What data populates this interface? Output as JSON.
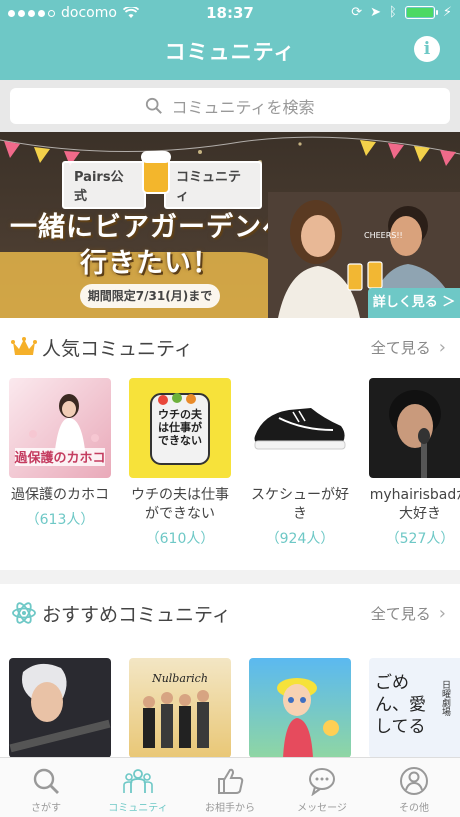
{
  "status_bar": {
    "carrier": "docomo",
    "time": "18:37"
  },
  "nav": {
    "title": "コミュニティ",
    "info_icon": "i"
  },
  "search": {
    "placeholder": "コミュニティを検索"
  },
  "banner": {
    "tag_left": "Pairs公式",
    "tag_right": "コミュニティ",
    "headline_line1": "一緒にビアガーデンへ",
    "headline_line2": "行きたい！",
    "period": "期間限定7/31(月)まで",
    "cheers": "CHEERS!!",
    "detail_button": "詳しく見る ＞"
  },
  "popular": {
    "title": "人気コミュニティ",
    "see_all": "全て見る",
    "items": [
      {
        "name": "過保護のカホコ",
        "count": "（613人）",
        "thumb_text": "過保護のカホコ"
      },
      {
        "name": "ウチの夫は仕事ができない",
        "count": "（610人）",
        "thumb_text": "ウチの夫は仕事ができない"
      },
      {
        "name": "スケシューが好き",
        "count": "（924人）"
      },
      {
        "name": "myhairisbadが大好き",
        "count": "（527人）"
      }
    ]
  },
  "recommended": {
    "title": "おすすめコミュニティ",
    "see_all": "全て見る",
    "thumb_texts": [
      "Nulbarich",
      "日曜劇場",
      "ごめん、愛してる"
    ]
  },
  "tabbar": [
    {
      "label": "さがす",
      "icon": "search-icon",
      "active": false
    },
    {
      "label": "コミュニティ",
      "icon": "community-icon",
      "active": true
    },
    {
      "label": "お相手から",
      "icon": "thumbs-up-icon",
      "active": false
    },
    {
      "label": "メッセージ",
      "icon": "message-icon",
      "active": false
    },
    {
      "label": "その他",
      "icon": "profile-icon",
      "active": false
    }
  ],
  "colors": {
    "accent": "#6ec8c6",
    "battery": "#4cd964"
  }
}
